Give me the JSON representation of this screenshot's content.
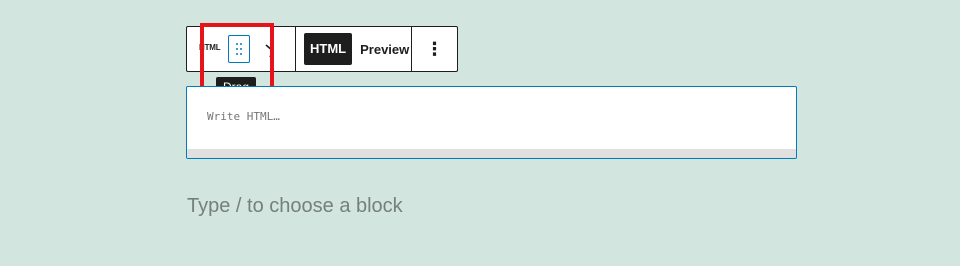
{
  "toolbar": {
    "block_icon_label": "HTML",
    "drag_tooltip": "Drag",
    "mode_html_label": "HTML",
    "mode_preview_label": "Preview",
    "more_icon": "⋮"
  },
  "html_block": {
    "placeholder": "Write HTML…"
  },
  "appender": {
    "placeholder": "Type / to choose a block"
  },
  "colors": {
    "background": "#d2e5df",
    "accent": "#007cba",
    "highlight": "#e5141a",
    "dark": "#1e1e1e"
  }
}
